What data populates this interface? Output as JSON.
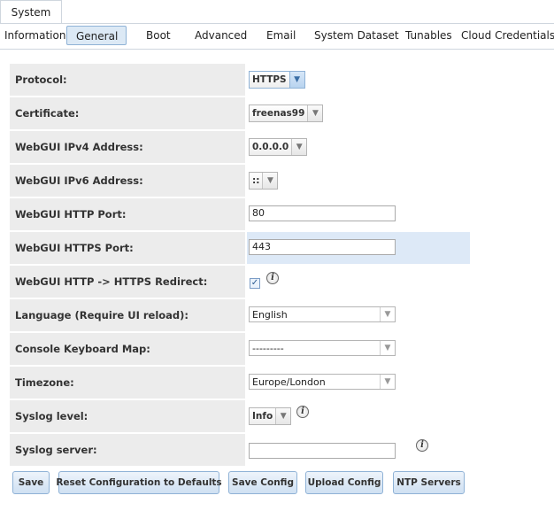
{
  "top_tab": {
    "label": "System"
  },
  "subtabs": [
    {
      "label": "Information"
    },
    {
      "label": "General",
      "active": true
    },
    {
      "label": "Boot"
    },
    {
      "label": "Advanced"
    },
    {
      "label": "Email"
    },
    {
      "label": "System Dataset"
    },
    {
      "label": "Tunables"
    },
    {
      "label": "Cloud Credentials"
    }
  ],
  "form": {
    "protocol": {
      "label": "Protocol:",
      "value": "HTTPS"
    },
    "certificate": {
      "label": "Certificate:",
      "value": "freenas99"
    },
    "ipv4": {
      "label": "WebGUI IPv4 Address:",
      "value": "0.0.0.0"
    },
    "ipv6": {
      "label": "WebGUI IPv6 Address:",
      "value": "::"
    },
    "http_port": {
      "label": "WebGUI HTTP Port:",
      "value": "80"
    },
    "https_port": {
      "label": "WebGUI HTTPS Port:",
      "value": "443"
    },
    "redirect": {
      "label": "WebGUI HTTP -> HTTPS Redirect:",
      "checked": true
    },
    "language": {
      "label": "Language (Require UI reload):",
      "value": "English"
    },
    "keymap": {
      "label": "Console Keyboard Map:",
      "value": "---------"
    },
    "timezone": {
      "label": "Timezone:",
      "value": "Europe/London"
    },
    "syslog_level": {
      "label": "Syslog level:",
      "value": "Info"
    },
    "syslog_server": {
      "label": "Syslog server:",
      "value": ""
    }
  },
  "buttons": {
    "save": "Save",
    "reset": "Reset Configuration to Defaults",
    "save_config": "Save Config",
    "upload_config": "Upload Config",
    "ntp_servers": "NTP Servers"
  },
  "icons": {
    "info": "i",
    "check": "✓",
    "dropdown": "▼"
  },
  "colors": {
    "accent": "#8fb2d6",
    "label_bg": "#ececec",
    "highlight_bg": "#dde9f7"
  }
}
